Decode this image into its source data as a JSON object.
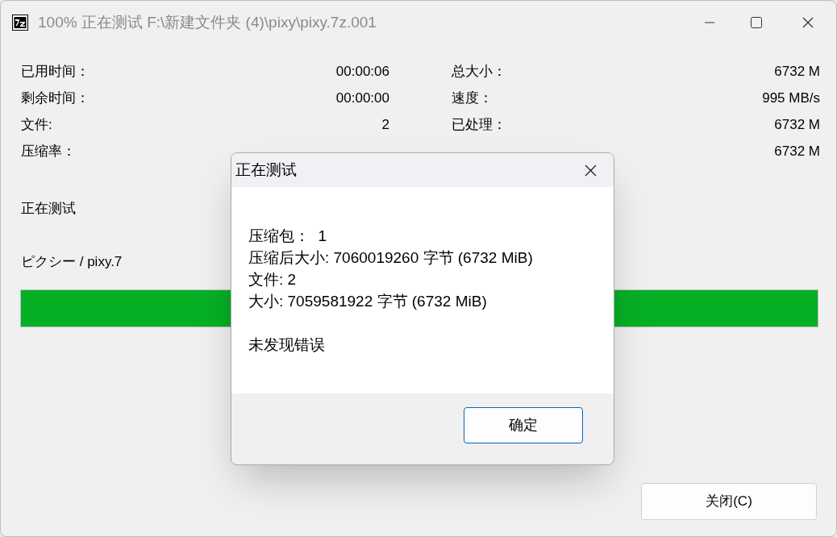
{
  "window": {
    "title": "100% 正在测试 F:\\新建文件夹 (4)\\pixy\\pixy.7z.001"
  },
  "stats": [
    {
      "label": "已用时间：",
      "value": "00:00:06"
    },
    {
      "label": "总大小：",
      "value": "6732 M"
    },
    {
      "label": "剩余时间：",
      "value": "00:00:00"
    },
    {
      "label": "速度：",
      "value": "995 MB/s"
    },
    {
      "label": "文件:",
      "value": "2"
    },
    {
      "label": "已处理：",
      "value": "6732 M"
    },
    {
      "label": "压缩率："
    },
    {
      "value": "6732 M"
    }
  ],
  "status": "正在测试",
  "current_file": "ピクシー / pixy.7",
  "progress": {
    "level": 1
  },
  "close_button": "关闭(C)",
  "dialog": {
    "title": "正在测试",
    "lines": [
      "压缩包：  1",
      "压缩后大小: 7060019260 字节 (6732 MiB)",
      "文件: 2",
      "大小: 7059581922 字节 (6732 MiB)"
    ],
    "result": "未发现错误",
    "ok_button": "确定"
  }
}
